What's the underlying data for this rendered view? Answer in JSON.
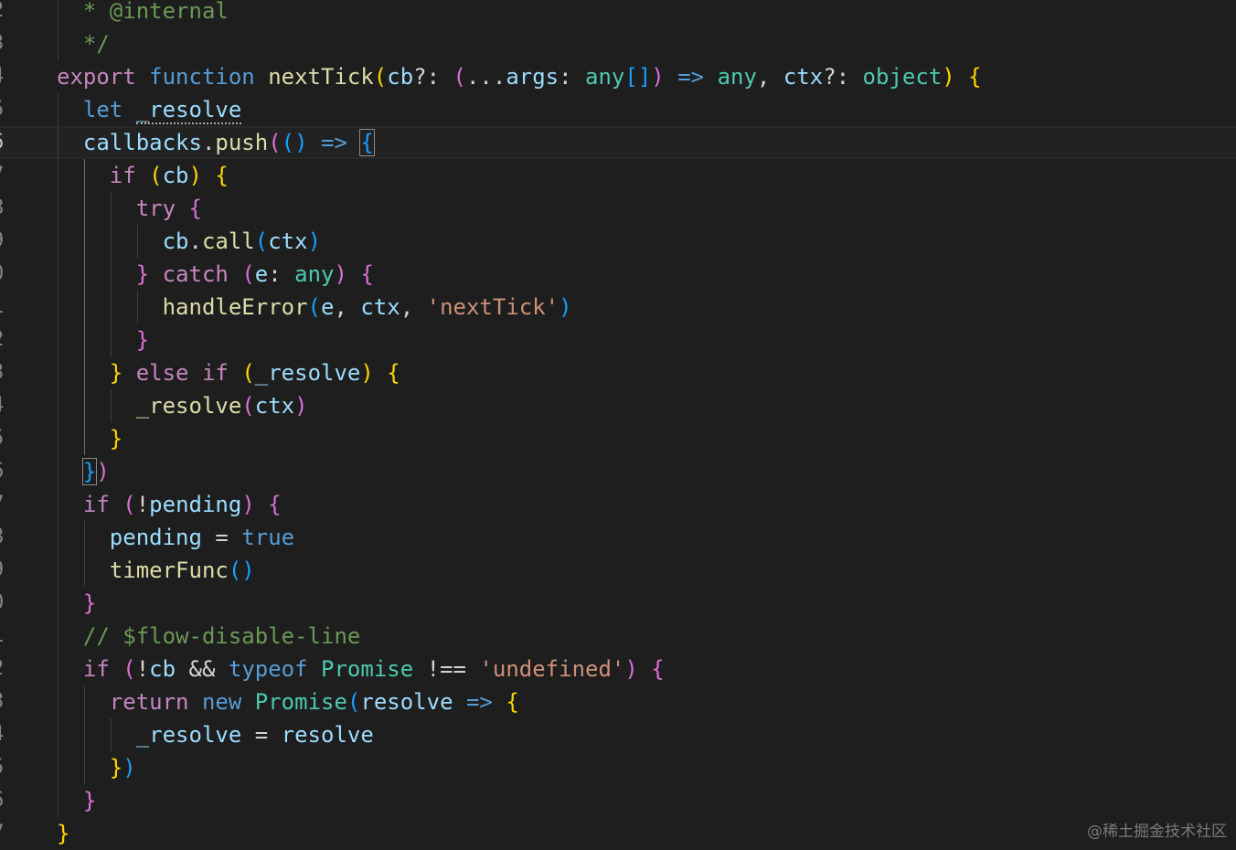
{
  "editor": {
    "lines": [
      {
        "num": "2",
        "tokens": [
          {
            "t": "  * @internal",
            "c": "cm"
          }
        ]
      },
      {
        "num": "3",
        "tokens": [
          {
            "t": "  */",
            "c": "cm"
          }
        ]
      },
      {
        "num": "4",
        "tokens": [
          {
            "t": "export",
            "c": "ctl"
          },
          {
            "t": " ",
            "c": "plain"
          },
          {
            "t": "function",
            "c": "kw"
          },
          {
            "t": " ",
            "c": "plain"
          },
          {
            "t": "nextTick",
            "c": "fn"
          },
          {
            "t": "(",
            "c": "p1"
          },
          {
            "t": "cb",
            "c": "var"
          },
          {
            "t": "?: ",
            "c": "op"
          },
          {
            "t": "(",
            "c": "p2"
          },
          {
            "t": "...",
            "c": "op"
          },
          {
            "t": "args",
            "c": "var"
          },
          {
            "t": ": ",
            "c": "op"
          },
          {
            "t": "any",
            "c": "typ"
          },
          {
            "t": "[]",
            "c": "p3"
          },
          {
            "t": ")",
            "c": "p2"
          },
          {
            "t": " ",
            "c": "plain"
          },
          {
            "t": "=>",
            "c": "kw"
          },
          {
            "t": " ",
            "c": "plain"
          },
          {
            "t": "any",
            "c": "typ"
          },
          {
            "t": ", ",
            "c": "op"
          },
          {
            "t": "ctx",
            "c": "var"
          },
          {
            "t": "?: ",
            "c": "op"
          },
          {
            "t": "object",
            "c": "typ"
          },
          {
            "t": ")",
            "c": "p1"
          },
          {
            "t": " ",
            "c": "plain"
          },
          {
            "t": "{",
            "c": "p1"
          }
        ]
      },
      {
        "num": "5",
        "tokens": [
          {
            "t": "  ",
            "c": "plain"
          },
          {
            "t": "let",
            "c": "kw"
          },
          {
            "t": " ",
            "c": "plain"
          },
          {
            "t": "_resolve",
            "c": "var",
            "extra": "squiggle"
          }
        ]
      },
      {
        "num": "6",
        "current": true,
        "tokens": [
          {
            "t": "  ",
            "c": "plain"
          },
          {
            "t": "callbacks",
            "c": "var"
          },
          {
            "t": ".",
            "c": "op"
          },
          {
            "t": "push",
            "c": "fn"
          },
          {
            "t": "(",
            "c": "p2"
          },
          {
            "t": "()",
            "c": "p3"
          },
          {
            "t": " ",
            "c": "plain"
          },
          {
            "t": "=>",
            "c": "kw"
          },
          {
            "t": " ",
            "c": "plain"
          },
          {
            "t": "{",
            "c": "p3",
            "extra": "bracket-box"
          }
        ]
      },
      {
        "num": "7",
        "tokens": [
          {
            "t": "    ",
            "c": "plain"
          },
          {
            "t": "if",
            "c": "ctl"
          },
          {
            "t": " ",
            "c": "plain"
          },
          {
            "t": "(",
            "c": "p1"
          },
          {
            "t": "cb",
            "c": "var"
          },
          {
            "t": ")",
            "c": "p1"
          },
          {
            "t": " ",
            "c": "plain"
          },
          {
            "t": "{",
            "c": "p1"
          }
        ]
      },
      {
        "num": "8",
        "tokens": [
          {
            "t": "      ",
            "c": "plain"
          },
          {
            "t": "try",
            "c": "ctl"
          },
          {
            "t": " ",
            "c": "plain"
          },
          {
            "t": "{",
            "c": "p2"
          }
        ]
      },
      {
        "num": "9",
        "tokens": [
          {
            "t": "        ",
            "c": "plain"
          },
          {
            "t": "cb",
            "c": "var"
          },
          {
            "t": ".",
            "c": "op"
          },
          {
            "t": "call",
            "c": "fn"
          },
          {
            "t": "(",
            "c": "p3"
          },
          {
            "t": "ctx",
            "c": "var"
          },
          {
            "t": ")",
            "c": "p3"
          }
        ]
      },
      {
        "num": "0",
        "tokens": [
          {
            "t": "      ",
            "c": "plain"
          },
          {
            "t": "}",
            "c": "p2"
          },
          {
            "t": " ",
            "c": "plain"
          },
          {
            "t": "catch",
            "c": "ctl"
          },
          {
            "t": " ",
            "c": "plain"
          },
          {
            "t": "(",
            "c": "p2"
          },
          {
            "t": "e",
            "c": "var"
          },
          {
            "t": ": ",
            "c": "op"
          },
          {
            "t": "any",
            "c": "typ"
          },
          {
            "t": ")",
            "c": "p2"
          },
          {
            "t": " ",
            "c": "plain"
          },
          {
            "t": "{",
            "c": "p2"
          }
        ]
      },
      {
        "num": "1",
        "tokens": [
          {
            "t": "        ",
            "c": "plain"
          },
          {
            "t": "handleError",
            "c": "fn"
          },
          {
            "t": "(",
            "c": "p3"
          },
          {
            "t": "e",
            "c": "var"
          },
          {
            "t": ", ",
            "c": "op"
          },
          {
            "t": "ctx",
            "c": "var"
          },
          {
            "t": ", ",
            "c": "op"
          },
          {
            "t": "'nextTick'",
            "c": "str"
          },
          {
            "t": ")",
            "c": "p3"
          }
        ]
      },
      {
        "num": "2",
        "tokens": [
          {
            "t": "      ",
            "c": "plain"
          },
          {
            "t": "}",
            "c": "p2"
          }
        ]
      },
      {
        "num": "3",
        "tokens": [
          {
            "t": "    ",
            "c": "plain"
          },
          {
            "t": "}",
            "c": "p1"
          },
          {
            "t": " ",
            "c": "plain"
          },
          {
            "t": "else",
            "c": "ctl"
          },
          {
            "t": " ",
            "c": "plain"
          },
          {
            "t": "if",
            "c": "ctl"
          },
          {
            "t": " ",
            "c": "plain"
          },
          {
            "t": "(",
            "c": "p1"
          },
          {
            "t": "_resolve",
            "c": "var"
          },
          {
            "t": ")",
            "c": "p1"
          },
          {
            "t": " ",
            "c": "plain"
          },
          {
            "t": "{",
            "c": "p1"
          }
        ]
      },
      {
        "num": "4",
        "tokens": [
          {
            "t": "      ",
            "c": "plain"
          },
          {
            "t": "_resolve",
            "c": "fn"
          },
          {
            "t": "(",
            "c": "p2"
          },
          {
            "t": "ctx",
            "c": "var"
          },
          {
            "t": ")",
            "c": "p2"
          }
        ]
      },
      {
        "num": "5",
        "tokens": [
          {
            "t": "    ",
            "c": "plain"
          },
          {
            "t": "}",
            "c": "p1"
          }
        ]
      },
      {
        "num": "6",
        "tokens": [
          {
            "t": "  ",
            "c": "plain"
          },
          {
            "t": "}",
            "c": "p3",
            "extra": "bracket-box"
          },
          {
            "t": ")",
            "c": "p2"
          }
        ]
      },
      {
        "num": "7",
        "tokens": [
          {
            "t": "  ",
            "c": "plain"
          },
          {
            "t": "if",
            "c": "ctl"
          },
          {
            "t": " ",
            "c": "plain"
          },
          {
            "t": "(",
            "c": "p2"
          },
          {
            "t": "!",
            "c": "op"
          },
          {
            "t": "pending",
            "c": "var"
          },
          {
            "t": ")",
            "c": "p2"
          },
          {
            "t": " ",
            "c": "plain"
          },
          {
            "t": "{",
            "c": "p2"
          }
        ]
      },
      {
        "num": "8",
        "tokens": [
          {
            "t": "    ",
            "c": "plain"
          },
          {
            "t": "pending",
            "c": "var"
          },
          {
            "t": " = ",
            "c": "op"
          },
          {
            "t": "true",
            "c": "kw"
          }
        ]
      },
      {
        "num": "9",
        "tokens": [
          {
            "t": "    ",
            "c": "plain"
          },
          {
            "t": "timerFunc",
            "c": "fn"
          },
          {
            "t": "()",
            "c": "p3"
          }
        ]
      },
      {
        "num": "0",
        "tokens": [
          {
            "t": "  ",
            "c": "plain"
          },
          {
            "t": "}",
            "c": "p2"
          }
        ]
      },
      {
        "num": "1",
        "tokens": [
          {
            "t": "  ",
            "c": "plain"
          },
          {
            "t": "// $flow-disable-line",
            "c": "cm"
          }
        ]
      },
      {
        "num": "2",
        "tokens": [
          {
            "t": "  ",
            "c": "plain"
          },
          {
            "t": "if",
            "c": "ctl"
          },
          {
            "t": " ",
            "c": "plain"
          },
          {
            "t": "(",
            "c": "p2"
          },
          {
            "t": "!",
            "c": "op"
          },
          {
            "t": "cb",
            "c": "var"
          },
          {
            "t": " && ",
            "c": "op"
          },
          {
            "t": "typeof",
            "c": "kw"
          },
          {
            "t": " ",
            "c": "plain"
          },
          {
            "t": "Promise",
            "c": "typ"
          },
          {
            "t": " !== ",
            "c": "op"
          },
          {
            "t": "'undefined'",
            "c": "str"
          },
          {
            "t": ")",
            "c": "p2"
          },
          {
            "t": " ",
            "c": "plain"
          },
          {
            "t": "{",
            "c": "p2"
          }
        ]
      },
      {
        "num": "3",
        "tokens": [
          {
            "t": "    ",
            "c": "plain"
          },
          {
            "t": "return",
            "c": "ctl"
          },
          {
            "t": " ",
            "c": "plain"
          },
          {
            "t": "new",
            "c": "kw"
          },
          {
            "t": " ",
            "c": "plain"
          },
          {
            "t": "Promise",
            "c": "typ"
          },
          {
            "t": "(",
            "c": "p3"
          },
          {
            "t": "resolve",
            "c": "var"
          },
          {
            "t": " ",
            "c": "plain"
          },
          {
            "t": "=>",
            "c": "kw"
          },
          {
            "t": " ",
            "c": "plain"
          },
          {
            "t": "{",
            "c": "p1"
          }
        ]
      },
      {
        "num": "4",
        "tokens": [
          {
            "t": "      ",
            "c": "plain"
          },
          {
            "t": "_resolve",
            "c": "var"
          },
          {
            "t": " = ",
            "c": "op"
          },
          {
            "t": "resolve",
            "c": "var"
          }
        ]
      },
      {
        "num": "5",
        "tokens": [
          {
            "t": "    ",
            "c": "plain"
          },
          {
            "t": "}",
            "c": "p1"
          },
          {
            "t": ")",
            "c": "p3"
          }
        ]
      },
      {
        "num": "6",
        "tokens": [
          {
            "t": "  ",
            "c": "plain"
          },
          {
            "t": "}",
            "c": "p2"
          }
        ]
      },
      {
        "num": "7",
        "tokens": [
          {
            "t": "}",
            "c": "p1"
          }
        ]
      }
    ]
  },
  "watermark": "@稀土掘金技术社区"
}
